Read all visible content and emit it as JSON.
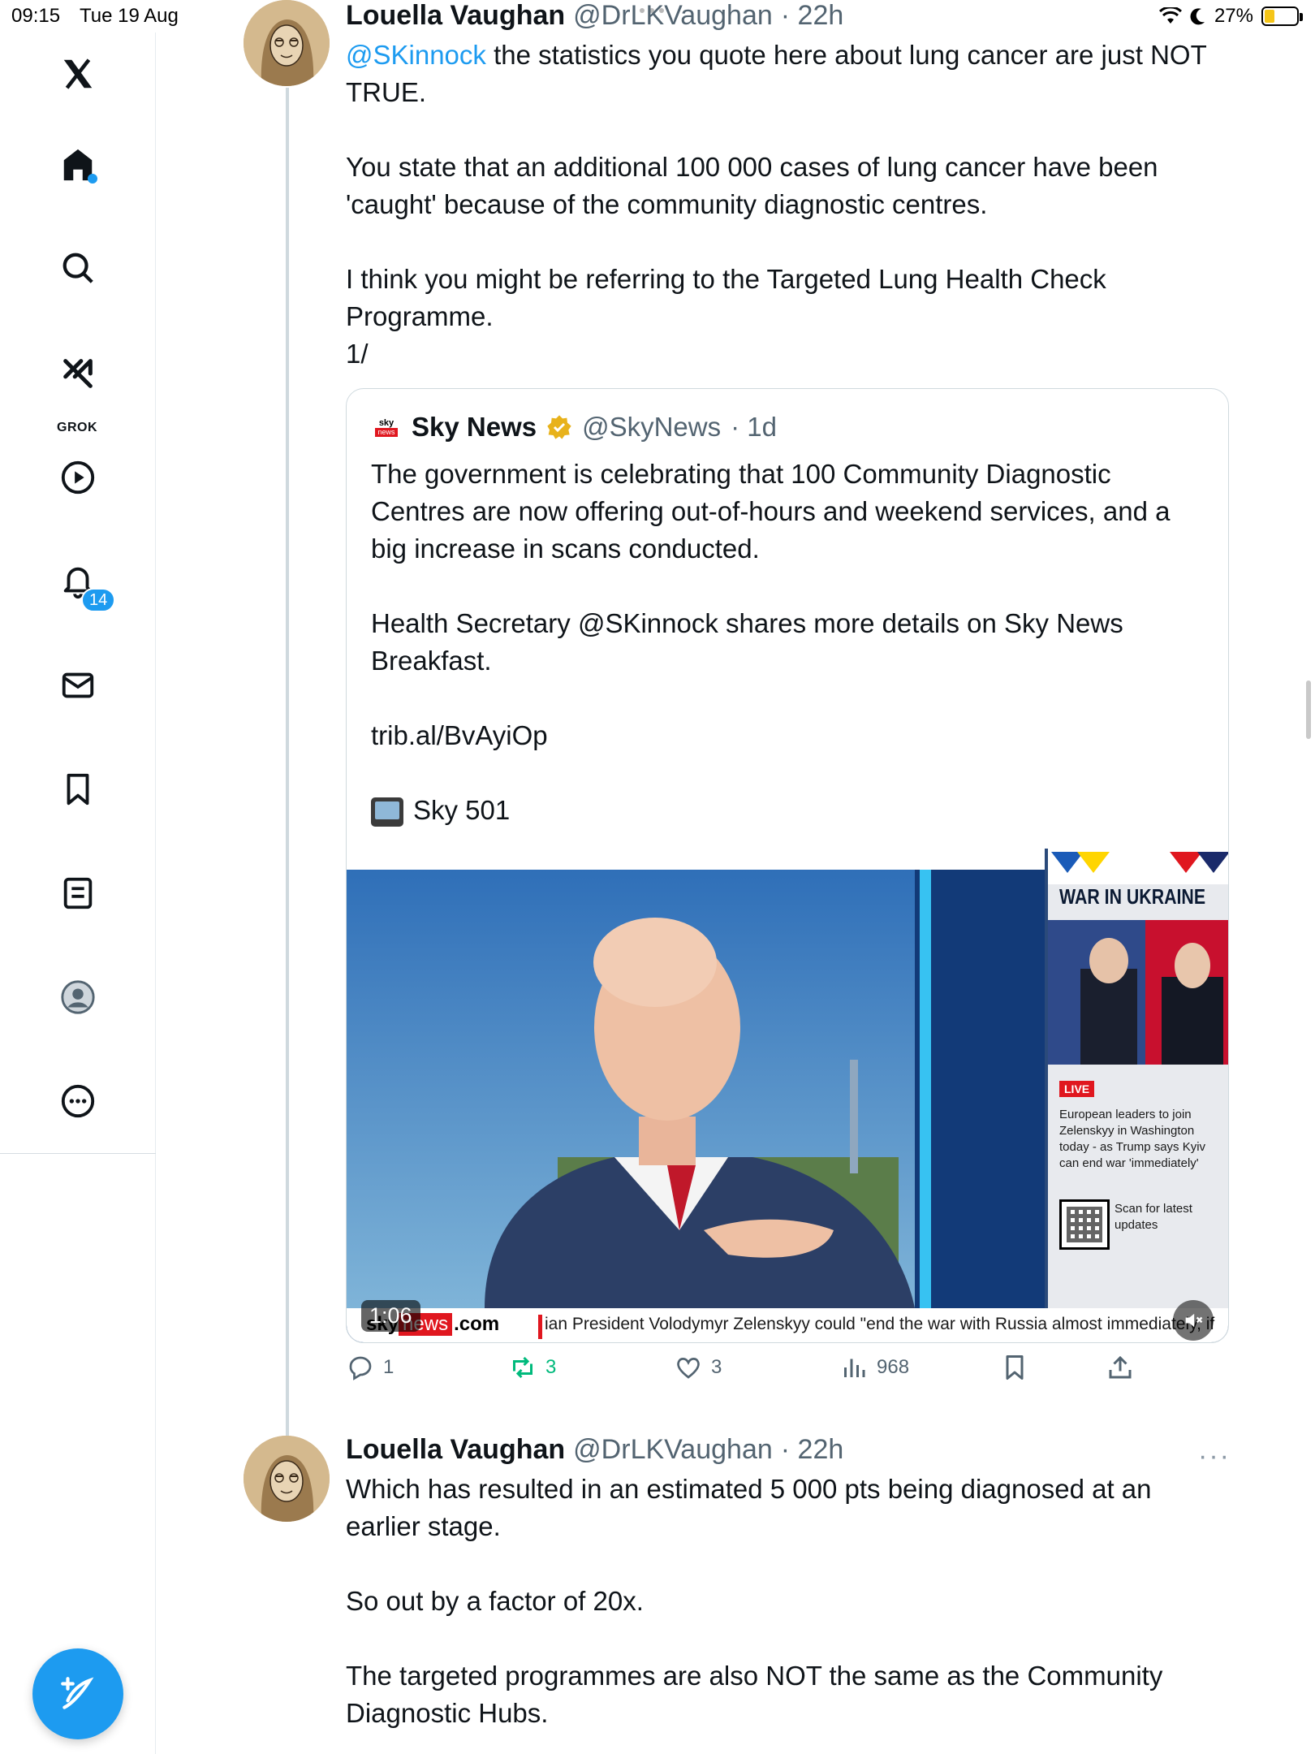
{
  "status_bar": {
    "time": "09:15",
    "date": "Tue 19 Aug",
    "battery": "27%"
  },
  "sidebar": {
    "items": [
      {
        "name": "home",
        "icon": "home-icon"
      },
      {
        "name": "explore",
        "icon": "search-icon"
      },
      {
        "name": "grok",
        "icon": "grok-icon",
        "label": "GROK"
      },
      {
        "name": "video",
        "icon": "play-icon"
      },
      {
        "name": "notifications",
        "icon": "bell-icon",
        "badge": "14"
      },
      {
        "name": "messages",
        "icon": "mail-icon"
      },
      {
        "name": "bookmarks",
        "icon": "bookmark-icon"
      },
      {
        "name": "lists",
        "icon": "list-icon"
      },
      {
        "name": "profile",
        "icon": "profile-icon"
      },
      {
        "name": "more",
        "icon": "more-icon"
      }
    ],
    "compose_icon": "compose-icon"
  },
  "tweet1": {
    "name": "Louella Vaughan",
    "handle": "@DrLKVaughan",
    "time": "· 22h",
    "mention": "@SKinnock",
    "text_after_mention": " the statistics you quote here about lung cancer are just NOT TRUE.\n\nYou state that an additional 100 000 cases of lung cancer have been 'caught' because of the community diagnostic centres.\n\nI think you might be referring to the Targeted Lung Health Check Programme.\n1/",
    "quote": {
      "name": "Sky News",
      "handle": "@SkyNews",
      "time": "· 1d",
      "logo_top": "sky",
      "logo_bottom": "news",
      "text": "The government is celebrating that 100 Community Diagnostic Centres are now offering out-of-hours and weekend services, and a big increase in scans conducted.\n\nHealth Secretary @SKinnock shares more details on Sky News Breakfast.\n\ntrib.al/BvAyiOp\n\n",
      "tv_label": "Sky 501",
      "video": {
        "duration": "1:06",
        "panel_title": "WAR IN UKRAINE",
        "live_label": "LIVE",
        "panel_headline": "European leaders to join Zelenskyy in Washington today - as Trump says Kyiv can end war 'immediately'",
        "qr_text": "Scan for latest updates",
        "ticker_sky": "sky",
        "ticker_news": "news",
        "ticker_com": ".com",
        "ticker_text": "ian President Volodymyr Zelenskyy could \"end the war with Russia almost immediately, if"
      }
    },
    "actions": {
      "replies": "1",
      "reposts": "3",
      "likes": "3",
      "views": "968"
    }
  },
  "tweet2": {
    "name": "Louella Vaughan",
    "handle": "@DrLKVaughan",
    "time": "· 22h",
    "more": "···",
    "text": "Which has resulted in an estimated 5 000 pts being diagnosed at an earlier stage.\n\nSo out by a factor of 20x.\n\nThe targeted programmes are also NOT the same as the Community Diagnostic Hubs."
  },
  "colors": {
    "accent": "#1d9bf0",
    "repost_active": "#00ba7c",
    "secondary_text": "#536471",
    "sky_red": "#e0171f"
  }
}
